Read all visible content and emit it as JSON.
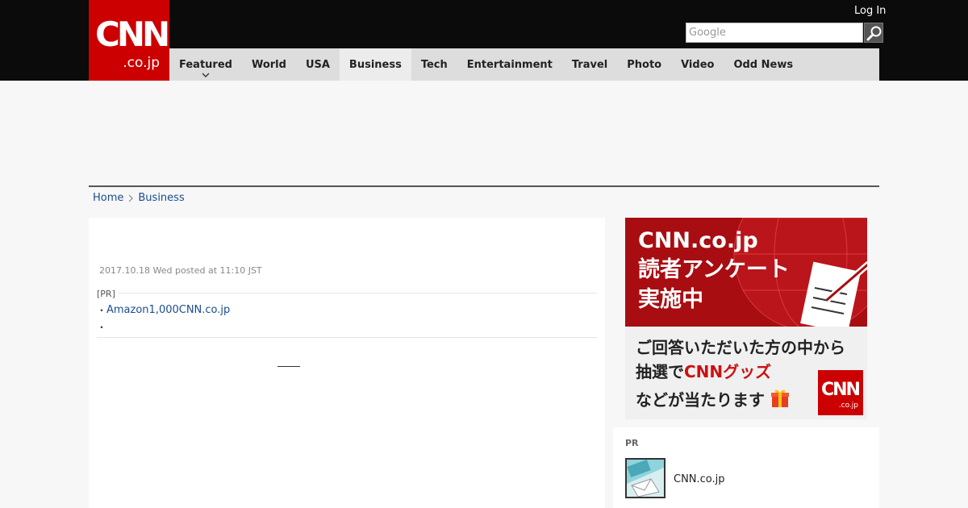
{
  "header": {
    "logo_text": "CNN",
    "logo_sub": ".co.jp",
    "login_label": "Log In",
    "search_placeholder": "Google"
  },
  "nav": {
    "items": [
      {
        "label": "Featured"
      },
      {
        "label": "World"
      },
      {
        "label": "USA"
      },
      {
        "label": "Business"
      },
      {
        "label": "Tech"
      },
      {
        "label": "Entertainment"
      },
      {
        "label": "Travel"
      },
      {
        "label": "Photo"
      },
      {
        "label": "Video"
      },
      {
        "label": "Odd News"
      }
    ],
    "active": "Business"
  },
  "breadcrumb": {
    "home": "Home",
    "current": "Business"
  },
  "article": {
    "posted": "2017.10.18 Wed posted at 11:10 JST",
    "pr_label": "[PR]",
    "pr_links": [
      "Amazon1,000CNN.co.jp",
      ""
    ]
  },
  "ad": {
    "line1": "CNN.co.jp",
    "line2": "読者アンケート",
    "line3": "実施中",
    "line4": "ご回答いただいた方の中から",
    "line5_a": "抽選で",
    "line5_b": "CNNグッズ",
    "line6": "などが当たります",
    "logo_text": "CNN",
    "logo_sub": ".co.jp"
  },
  "sidebar": {
    "pr_heading": "PR",
    "item_title": "CNN.co.jp"
  },
  "colors": {
    "brand_red": "#cc0000",
    "header_bg": "#0b0b0b",
    "nav_bg": "#dddddd",
    "link": "#1a4d8f"
  }
}
